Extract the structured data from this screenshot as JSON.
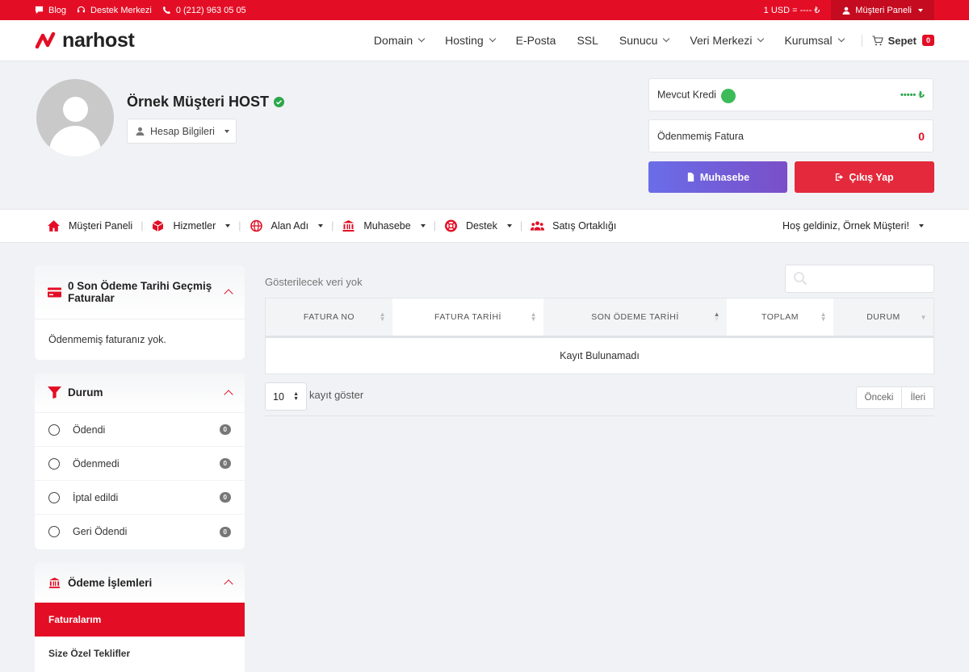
{
  "topbar": {
    "blog": "Blog",
    "support": "Destek Merkezi",
    "phone": "0 (212) 963 05 05",
    "currency": "1 USD = ---- ₺",
    "panel": "Müşteri Paneli"
  },
  "header": {
    "logo": "narhost",
    "nav": [
      "Domain",
      "Hosting",
      "E-Posta",
      "SSL",
      "Sunucu",
      "Veri Merkezi",
      "Kurumsal"
    ],
    "cart_label": "Sepet",
    "cart_count": "0"
  },
  "profile": {
    "name": "Örnek Müşteri HOST",
    "account_button": "Hesap Bilgileri",
    "credit_label": "Mevcut Kredi",
    "credit_value": "••••• ₺",
    "unpaid_label": "Ödenmemiş Fatura",
    "unpaid_value": "0",
    "accounting_button": "Muhasebe",
    "logout_button": "Çıkış Yap"
  },
  "subnav": {
    "items": [
      "Müşteri Paneli",
      "Hizmetler",
      "Alan Adı",
      "Muhasebe",
      "Destek",
      "Satış Ortaklığı"
    ],
    "welcome": "Hoş geldiniz, Örnek Müşteri!"
  },
  "sidebar": {
    "overdue_title": "0 Son Ödeme Tarihi Geçmiş Faturalar",
    "overdue_text": "Ödenmemiş faturanız yok.",
    "status_title": "Durum",
    "statuses": [
      {
        "label": "Ödendi",
        "count": "0"
      },
      {
        "label": "Ödenmedi",
        "count": "0"
      },
      {
        "label": "İptal edildi",
        "count": "0"
      },
      {
        "label": "Geri Ödendi",
        "count": "0"
      }
    ],
    "payment_title": "Ödeme İşlemleri",
    "payment_items": [
      "Faturalarım",
      "Size Özel Teklifler"
    ]
  },
  "table": {
    "info": "Gösterilecek veri yok",
    "columns": [
      "FATURA NO",
      "FATURA TARİHİ",
      "SON ÖDEME TARİHİ",
      "TOPLAM",
      "DURUM"
    ],
    "empty": "Kayıt Bulunamadı",
    "page_length": "10",
    "page_length_label": "kayıt göster",
    "prev": "Önceki",
    "next": "İleri"
  },
  "colors": {
    "brand_red": "#e30e25",
    "accounting_gradient_start": "#6a6de8",
    "accounting_gradient_end": "#7a4fc8",
    "verified_green": "#2aa74a"
  }
}
